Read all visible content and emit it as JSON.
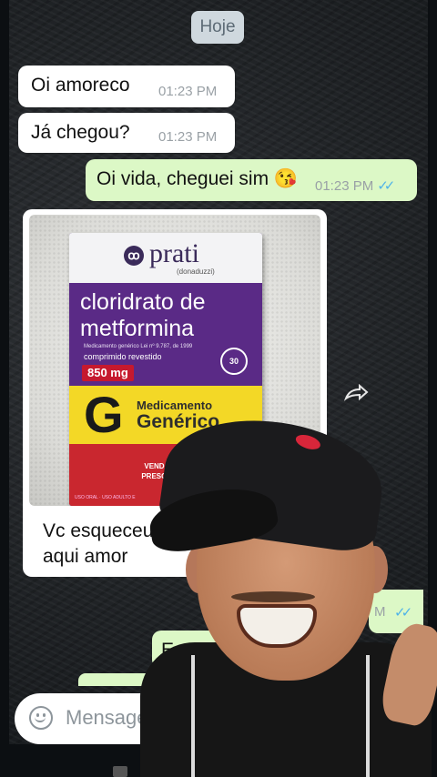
{
  "chat": {
    "date_chip": "Hoje",
    "messages": [
      {
        "direction": "in",
        "text": "Oi amoreco",
        "time": "01:23 PM"
      },
      {
        "direction": "in",
        "text": "Já chegou?",
        "time": "01:23 PM"
      },
      {
        "direction": "out",
        "text": "Oi vida, cheguei sim 😘",
        "time": "01:23 PM",
        "ticks": "✓✓"
      }
    ],
    "image_message": {
      "caption_line1": "Vc esqueceu o seu",
      "caption_line2": "aqui amor",
      "box": {
        "brand": "prati",
        "brand_sub": "(donaduzzi)",
        "drug_line1": "cloridrato de",
        "drug_line2": "metformina",
        "info": "Medicamento genérico Lei nº 9.787, de 1999",
        "form": "comprimido revestido",
        "dose": "850 mg",
        "qty": "30",
        "generic_letter": "G",
        "generic_label1": "Medicamento",
        "generic_label2": "Genérico",
        "sale_line1": "VENDA SOB",
        "sale_line2": "PRESCRIÇÃO",
        "footer": "USO ORAL · USO ADULTO E"
      }
    },
    "partial_out_time": "M",
    "partial_out_ticks": "✓✓",
    "partial_out_text": "Esqu"
  },
  "input": {
    "placeholder": "Mensage"
  },
  "icons": {
    "forward": "forward-icon",
    "emoji": "emoji-icon"
  },
  "colors": {
    "incoming_bubble": "#ffffff",
    "outgoing_bubble": "#dcf8c6",
    "read_ticks": "#4fb3e8"
  }
}
